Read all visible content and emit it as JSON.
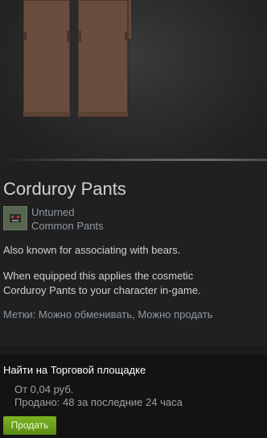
{
  "item": {
    "name": "Corduroy Pants",
    "game": "Unturned",
    "type": "Common Pants",
    "description_line1": "Also known for associating with bears.",
    "description_line2": "When equipped this applies the cosmetic",
    "description_line3": "Corduroy Pants to your character in-game.",
    "tags": "Метки: Можно обменивать, Можно продать"
  },
  "market": {
    "title": "Найти на Торговой площадке",
    "price": "От 0,04 руб.",
    "sold": "Продано: 48 за последние 24 часа",
    "sell_label": "Продать"
  },
  "colors": {
    "pants": "#6b4d3e",
    "sell_button": "#6aa11c"
  }
}
